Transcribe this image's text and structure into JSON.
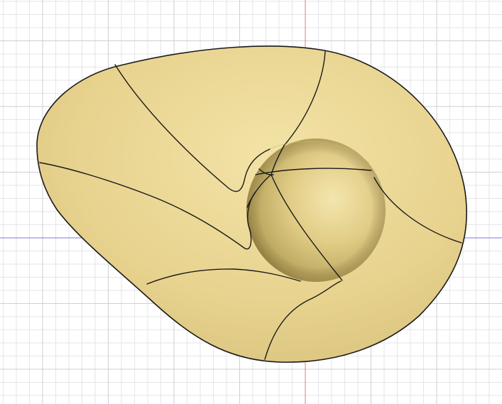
{
  "viewport": {
    "background": "#ffffff",
    "grid_minor_color": "#e6e6ea",
    "grid_major_color": "#cfcfd6",
    "axis_x_color": "#7b7bd9",
    "axis_y_color": "#e07b7b"
  },
  "model": {
    "surface_color": "#ecd996",
    "surface_shade_color": "#c9b56d",
    "edge_color": "#1a1a1a"
  }
}
